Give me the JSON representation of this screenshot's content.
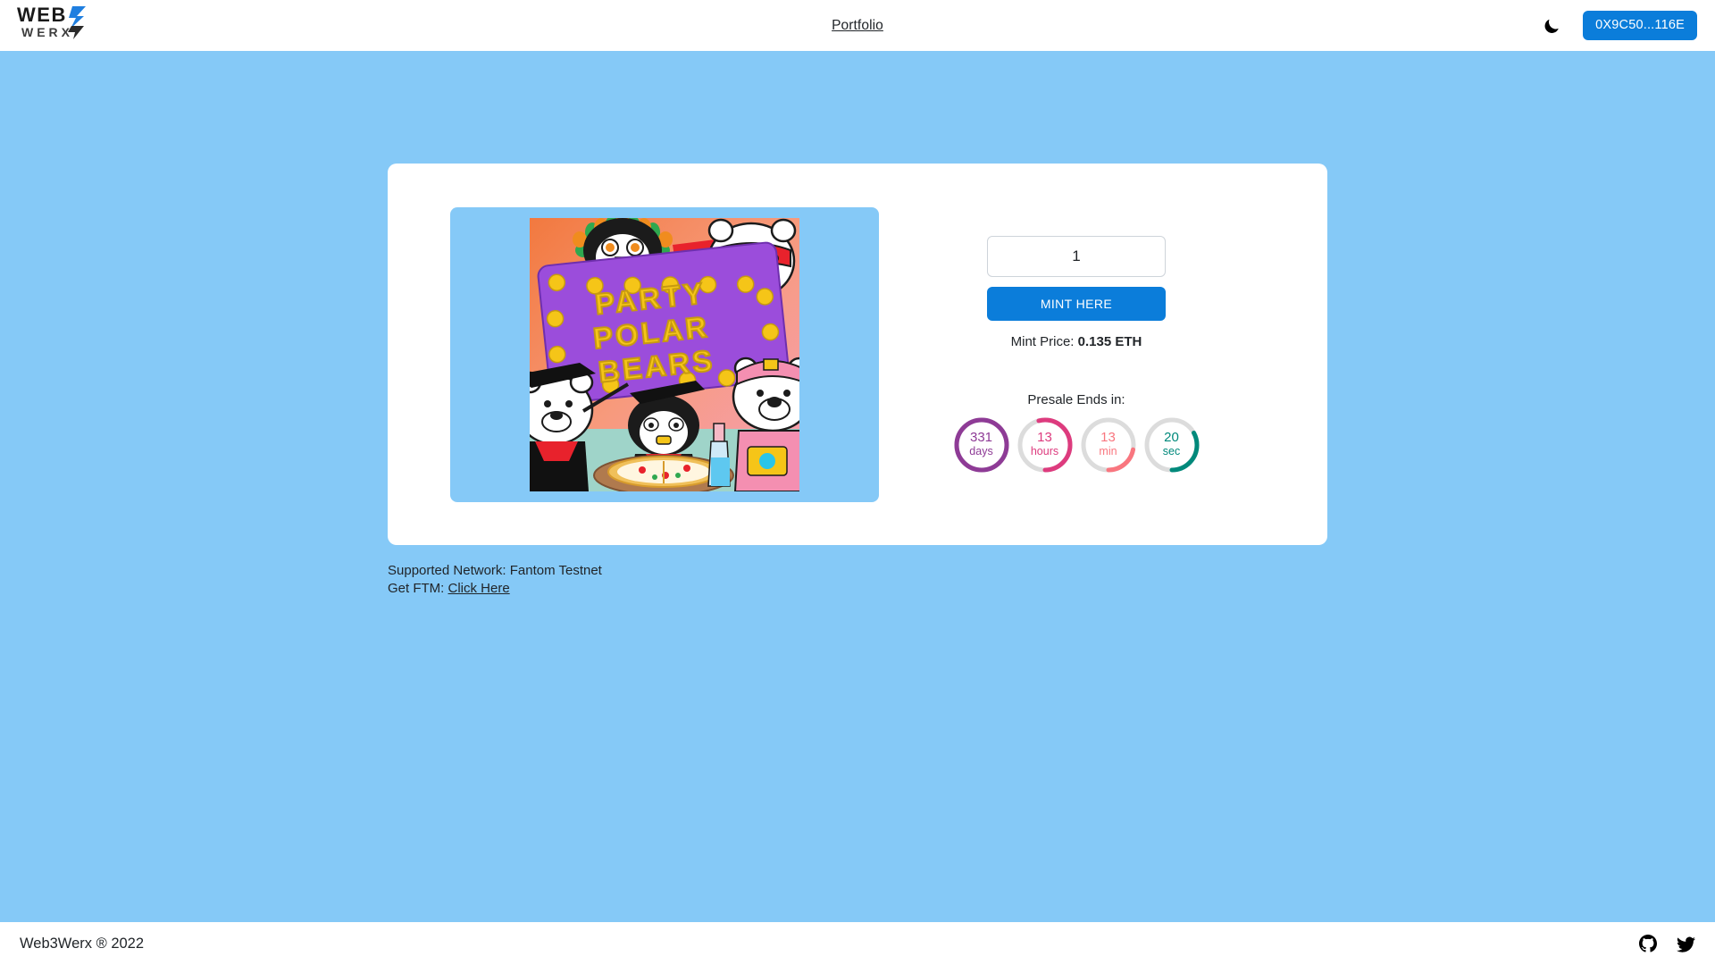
{
  "navbar": {
    "brand_primary": "WEB",
    "brand_secondary": "WERX",
    "portfolio_link": "Portfolio",
    "theme_icon": "moon-icon",
    "wallet_address": "0X9C50...116E"
  },
  "mint": {
    "quantity_value": "1",
    "quantity_placeholder": "1",
    "mint_button_label": "MINT HERE",
    "price_label": "Mint Price: ",
    "price_value": "0.135 ETH",
    "artwork_title": "PARTY POLAR BEARS"
  },
  "presale": {
    "heading": "Presale Ends in:",
    "units": [
      {
        "value": "331",
        "unit": "days",
        "color": "#8e3b96",
        "progress": 100
      },
      {
        "value": "13",
        "unit": "hours",
        "color": "#dd3b7e",
        "progress": 54
      },
      {
        "value": "13",
        "unit": "min",
        "color": "#f9767f",
        "progress": 22
      },
      {
        "value": "20",
        "unit": "sec",
        "color": "#00897b",
        "progress": 33
      }
    ]
  },
  "network": {
    "supported_label": "Supported Network: Fantom Testnet",
    "get_label": "Get FTM: ",
    "get_link": "Click Here"
  },
  "footer": {
    "copyright": "Web3Werx ® 2022",
    "github_icon": "github-icon",
    "twitter_icon": "twitter-icon"
  },
  "colors": {
    "background": "#85c9f7",
    "accent": "#0b7dda",
    "card": "#ffffff"
  }
}
